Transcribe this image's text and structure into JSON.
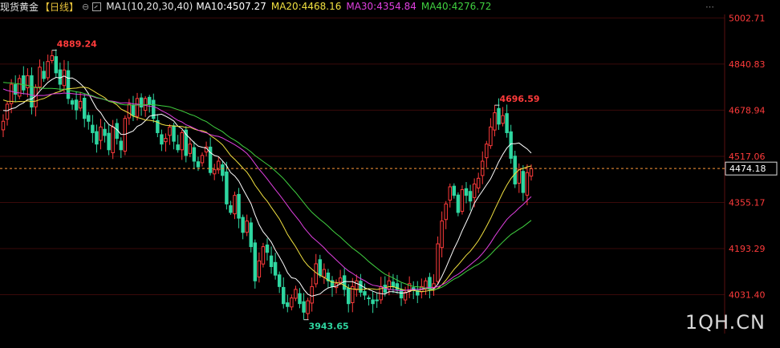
{
  "header": {
    "title": "现货黄金",
    "period": "【日线】",
    "cycle_icon": "⊖",
    "ma_set": "MA1(10,20,30,40)",
    "ma10": "MA10:4507.27",
    "ma20": "MA20:4468.16",
    "ma30": "MA30:4354.84",
    "ma40": "MA40:4276.72"
  },
  "menu_icon": "⋯",
  "watermark": "1QH.CN",
  "colors": {
    "up": "#ff3b3b",
    "down": "#2ed6a0",
    "ma10": "#ffffff",
    "ma20": "#f0e040",
    "ma30": "#e040e0",
    "ma40": "#40d040",
    "grid": "#3a0a0a",
    "axis_text": "#ff3b3b",
    "current": "#ff9a3a"
  },
  "chart_data": {
    "type": "candlestick",
    "y_ticks": [
      5002.71,
      4840.83,
      4678.94,
      4517.06,
      4355.17,
      4193.29,
      4031.4
    ],
    "y_tick_labels": [
      "5002.71",
      "4840.83",
      "4678.94",
      "4517.06",
      "4355.17",
      "4193.29",
      "4031.40"
    ],
    "ylim": [
      3895,
      5015
    ],
    "current_price": 4474.18,
    "current_label": "4474.18",
    "annotations": [
      {
        "label": "4889.24",
        "index": 12,
        "value": 4889.24,
        "kind": "high"
      },
      {
        "label": "4696.59",
        "index": 121,
        "value": 4696.59,
        "kind": "high"
      },
      {
        "label": "3943.65",
        "index": 74,
        "value": 3943.65,
        "kind": "low"
      }
    ],
    "closes": [
      4640,
      4700,
      4770,
      4735,
      4790,
      4750,
      4800,
      4690,
      4760,
      4830,
      4790,
      4850,
      4870,
      4810,
      4770,
      4820,
      4720,
      4700,
      4680,
      4710,
      4650,
      4640,
      4600,
      4560,
      4620,
      4590,
      4540,
      4620,
      4580,
      4540,
      4650,
      4700,
      4660,
      4720,
      4690,
      4720,
      4700,
      4650,
      4600,
      4560,
      4580,
      4620,
      4570,
      4540,
      4600,
      4520,
      4560,
      4500,
      4480,
      4520,
      4550,
      4460,
      4470,
      4500,
      4450,
      4350,
      4320,
      4380,
      4300,
      4250,
      4290,
      4200,
      4080,
      4150,
      4200,
      4180,
      4130,
      4100,
      4060,
      4000,
      3990,
      4020,
      4050,
      4000,
      3970,
      4010,
      4060,
      4140,
      4100,
      4120,
      4080,
      4060,
      4070,
      4090,
      4050,
      4000,
      4060,
      4080,
      4040,
      4030,
      4020,
      4000,
      4010,
      4060,
      4040,
      4080,
      4060,
      4050,
      4020,
      4040,
      4070,
      4050,
      4030,
      4060,
      4080,
      4050,
      4070,
      4210,
      4290,
      4350,
      4410,
      4380,
      4320,
      4400,
      4380,
      4360,
      4420,
      4440,
      4500,
      4560,
      4620,
      4670,
      4630,
      4660,
      4600,
      4510,
      4420,
      4470,
      4390,
      4460,
      4474
    ],
    "ohlc_note": "",
    "ma_series": [
      {
        "name": "MA10",
        "window": 10
      },
      {
        "name": "MA20",
        "window": 20
      },
      {
        "name": "MA30",
        "window": 30
      },
      {
        "name": "MA40",
        "window": 40
      }
    ]
  }
}
